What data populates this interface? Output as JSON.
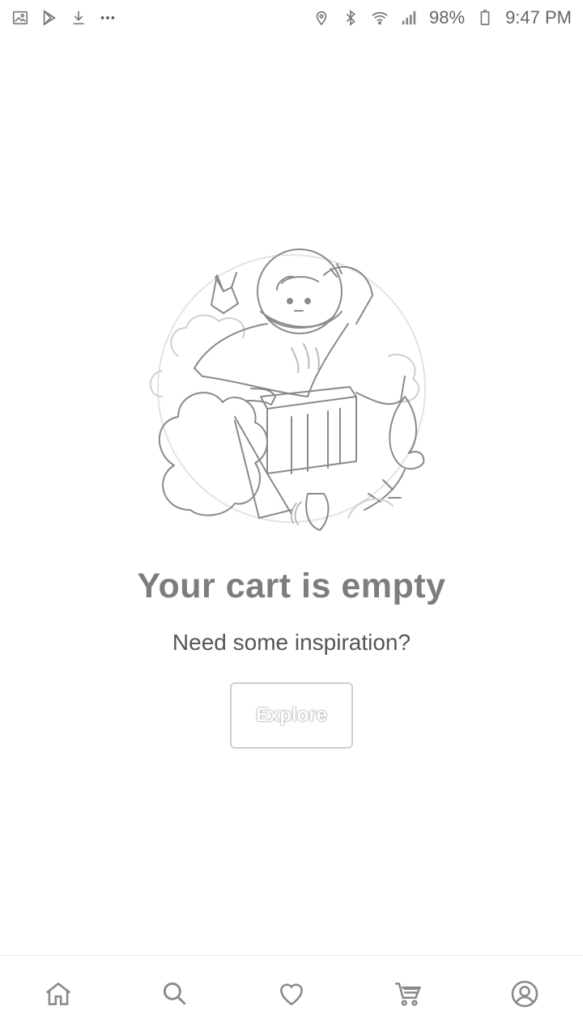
{
  "status_bar": {
    "battery": "98%",
    "time": "9:47 PM",
    "left_icons": [
      "gallery-icon",
      "play-store-icon",
      "download-icon",
      "more-dots-icon"
    ],
    "right_icons": [
      "location-icon",
      "bluetooth-icon",
      "wifi-icon",
      "signal-icon",
      "battery-icon"
    ]
  },
  "empty_state": {
    "title": "Your cart is empty",
    "subtitle": "Need some inspiration?",
    "button_label": "Explore",
    "illustration": "astronaut-box-illustration"
  },
  "bottom_nav": {
    "items": [
      {
        "icon": "home-icon"
      },
      {
        "icon": "search-icon"
      },
      {
        "icon": "heart-icon"
      },
      {
        "icon": "cart-icon"
      },
      {
        "icon": "profile-icon"
      }
    ]
  },
  "colors": {
    "background": "#ffffff",
    "title": "#7d7d7d",
    "subtitle": "#555555",
    "icon": "#888888",
    "border": "#cfcfcf"
  }
}
